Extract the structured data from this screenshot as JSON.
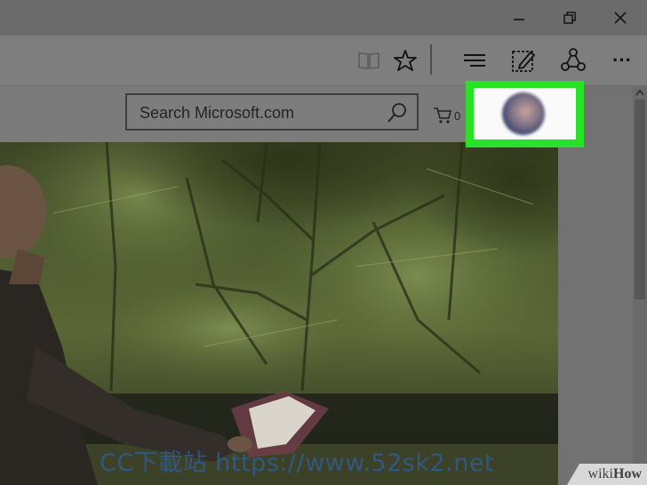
{
  "browser": {
    "window_controls": {
      "minimize": "–",
      "restore": "❐",
      "close": "✕"
    },
    "toolbar_icons": [
      "reading-view-icon",
      "favorites-star-icon",
      "hub-icon",
      "web-note-icon",
      "share-icon",
      "more-icon"
    ],
    "more_label": "···"
  },
  "site": {
    "search": {
      "placeholder": "Search Microsoft.com"
    },
    "cart": {
      "count": "0"
    }
  },
  "watermark": {
    "text": "CC下載站 https://www.52sk2.net"
  },
  "wikihow": {
    "part1": "wiki",
    "part2": "How"
  },
  "colors": {
    "highlight": "#27e227",
    "watermark": "#2d5f9a"
  }
}
